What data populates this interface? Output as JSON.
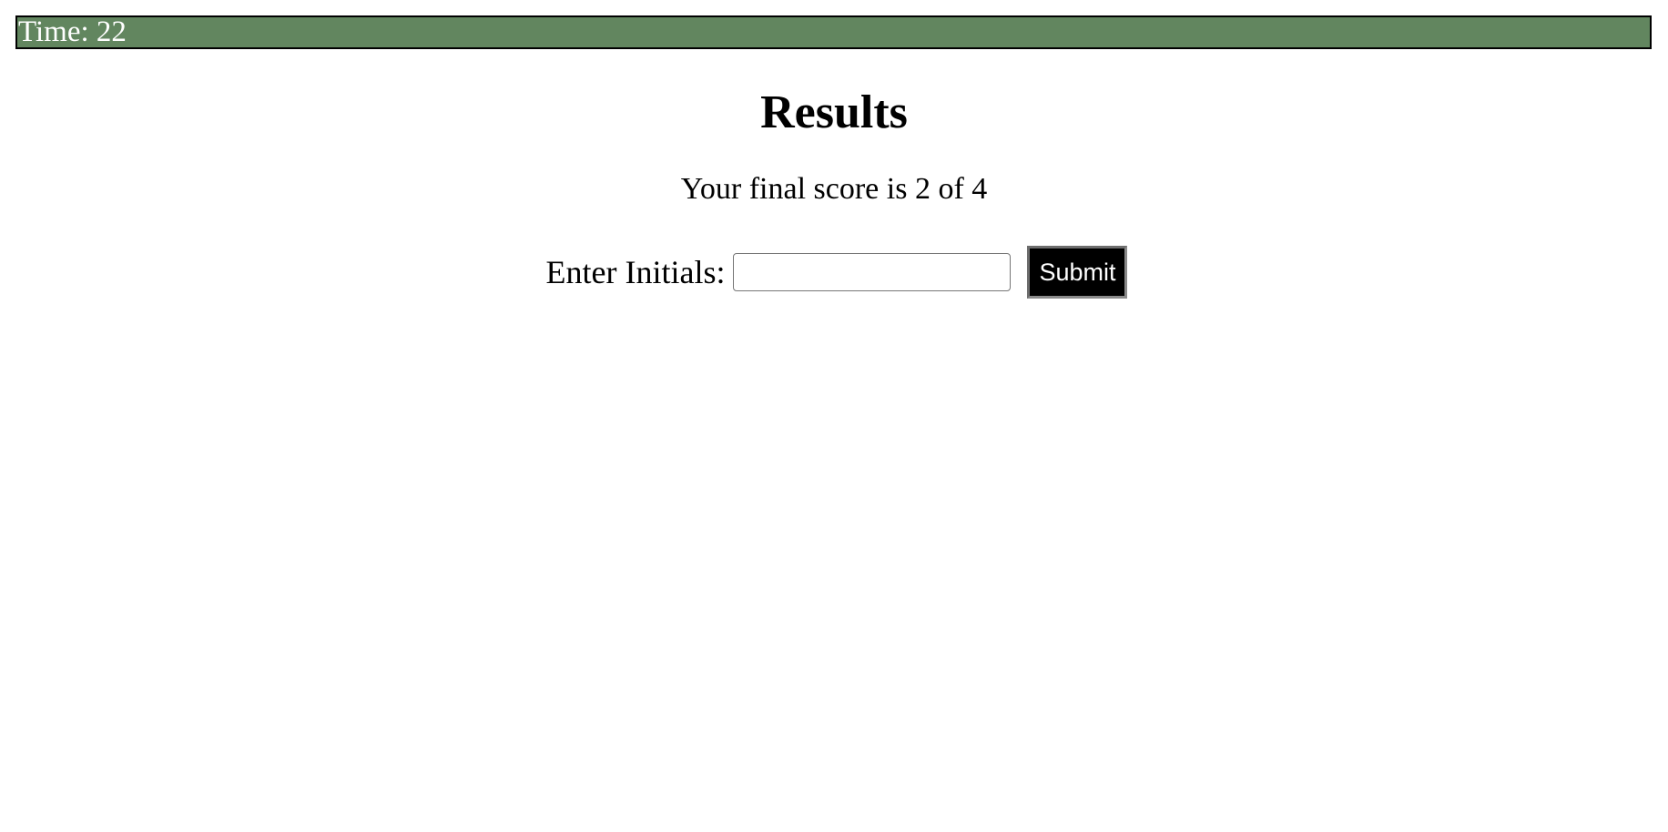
{
  "timer": {
    "label": "Time:",
    "value": "22"
  },
  "results": {
    "title": "Results",
    "score_prefix": "Your final score is",
    "score": "2",
    "score_of": "of",
    "total": "4"
  },
  "form": {
    "initials_label": "Enter Initials:",
    "initials_value": "",
    "submit_label": "Submit"
  },
  "colors": {
    "timer_bar_background": "#62865f",
    "submit_background": "#000000"
  }
}
